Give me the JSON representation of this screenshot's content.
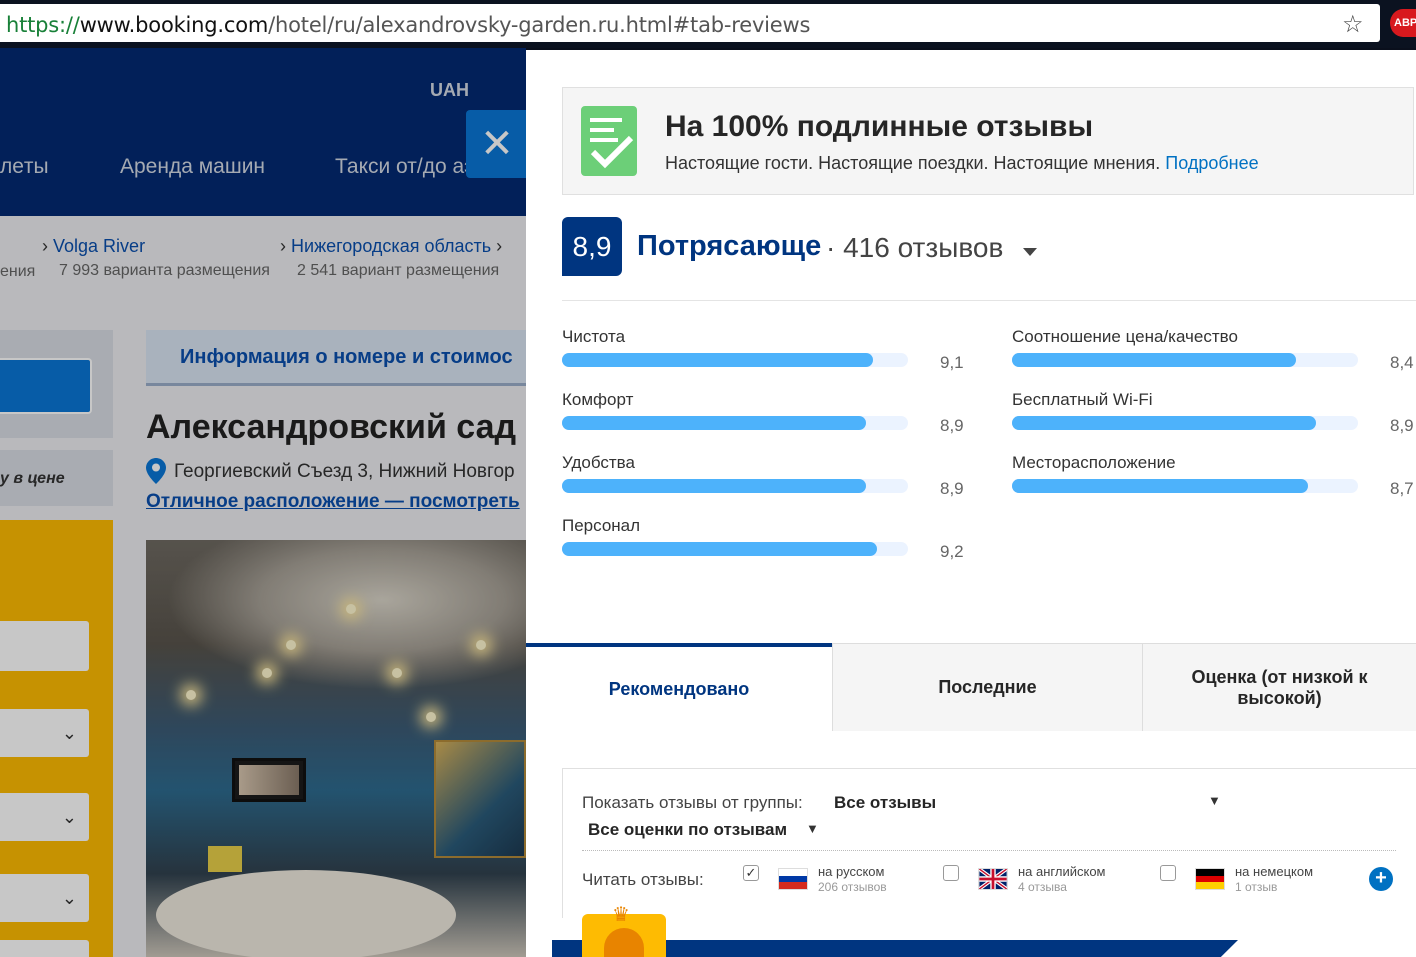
{
  "browser": {
    "url_scheme": "https://",
    "url_host": "www.booking.com",
    "url_path": "/hotel/ru/alexandrovsky-garden.ru.html#tab-reviews",
    "bookmark_icon": "star-icon",
    "extension_label": "ABP"
  },
  "background_page": {
    "currency": "UAH",
    "nav_items": [
      "лeты",
      "Аренда машин",
      "Такси от/до аэ"
    ],
    "breadcrumbs": [
      {
        "title": "",
        "subtitle": "ения"
      },
      {
        "title": "Volga River",
        "subtitle": "7 993 варианта размещения"
      },
      {
        "title": "Нижегородская область",
        "subtitle": "2 541 вариант размещения"
      }
    ],
    "tab_info": "Информация о номере и стоимос",
    "price_note": "у в цене",
    "hotel_name": "Александровский сад",
    "address": "Георгиевский Съезд 3, Нижний Новгор",
    "location_link": "Отличное расположение — посмотреть"
  },
  "reviews": {
    "verified_title": "На 100% подлинные отзывы",
    "verified_text": "Настоящие гости. Настоящие поездки. Настоящие мнения.",
    "verified_link": "Подробнее",
    "score": "8,9",
    "score_word": "Потрясающе",
    "review_count": "· 416 отзывов",
    "categories": [
      {
        "label": "Чистота",
        "value": "9,1",
        "score": 9.1
      },
      {
        "label": "Соотношение цена/качество",
        "value": "8,4",
        "score": 8.4
      },
      {
        "label": "Комфорт",
        "value": "8,9",
        "score": 8.9
      },
      {
        "label": "Бесплатный Wi-Fi",
        "value": "8,9",
        "score": 8.9
      },
      {
        "label": "Удобства",
        "value": "8,9",
        "score": 8.9
      },
      {
        "label": "Месторасположение",
        "value": "8,7",
        "score": 8.7
      },
      {
        "label": "Персонал",
        "value": "9,2",
        "score": 9.2
      }
    ],
    "sort_tabs": [
      {
        "label": "Рекомендовано",
        "active": true
      },
      {
        "label": "Последние",
        "active": false
      },
      {
        "label": "Оценка (от низкой к высокой)",
        "active": false
      }
    ],
    "filters": {
      "group_label": "Показать отзывы от группы:",
      "group_value": "Все отзывы",
      "scores_value": "Все оценки по отзывам",
      "read_label": "Читать отзывы:",
      "languages": [
        {
          "name": "на русском",
          "count": "206 отзывов",
          "checked": true,
          "flag": "ru"
        },
        {
          "name": "на английском",
          "count": "4 отзыва",
          "checked": false,
          "flag": "gb"
        },
        {
          "name": "на немецком",
          "count": "1 отзыв",
          "checked": false,
          "flag": "de"
        }
      ]
    }
  },
  "colors": {
    "brand_dark": "#003580",
    "bar_fill": "#4db2fb",
    "link": "#0071c2",
    "accent_yellow": "#febb02"
  }
}
